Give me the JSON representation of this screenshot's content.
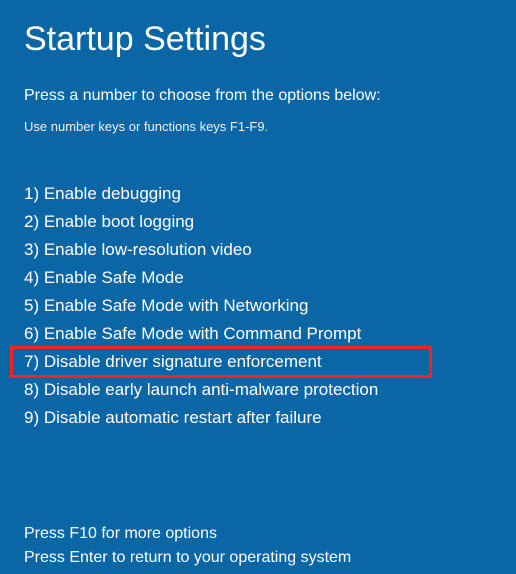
{
  "title": "Startup Settings",
  "subtitle": "Press a number to choose from the options below:",
  "instruction": "Use number keys or functions keys F1-F9.",
  "options": [
    {
      "n": 1,
      "label": "Enable debugging",
      "highlight": false
    },
    {
      "n": 2,
      "label": "Enable boot logging",
      "highlight": false
    },
    {
      "n": 3,
      "label": "Enable low-resolution video",
      "highlight": false
    },
    {
      "n": 4,
      "label": "Enable Safe Mode",
      "highlight": false
    },
    {
      "n": 5,
      "label": "Enable Safe Mode with Networking",
      "highlight": false
    },
    {
      "n": 6,
      "label": "Enable Safe Mode with Command Prompt",
      "highlight": false
    },
    {
      "n": 7,
      "label": "Disable driver signature enforcement",
      "highlight": true
    },
    {
      "n": 8,
      "label": "Disable early launch anti-malware protection",
      "highlight": false
    },
    {
      "n": 9,
      "label": "Disable automatic restart after failure",
      "highlight": false
    }
  ],
  "footer": {
    "more": "Press F10 for more options",
    "return": "Press Enter to return to your operating system"
  },
  "colors": {
    "bg": "#0b66a6",
    "text": "#ffffff",
    "highlight": "#ff1f1f"
  }
}
